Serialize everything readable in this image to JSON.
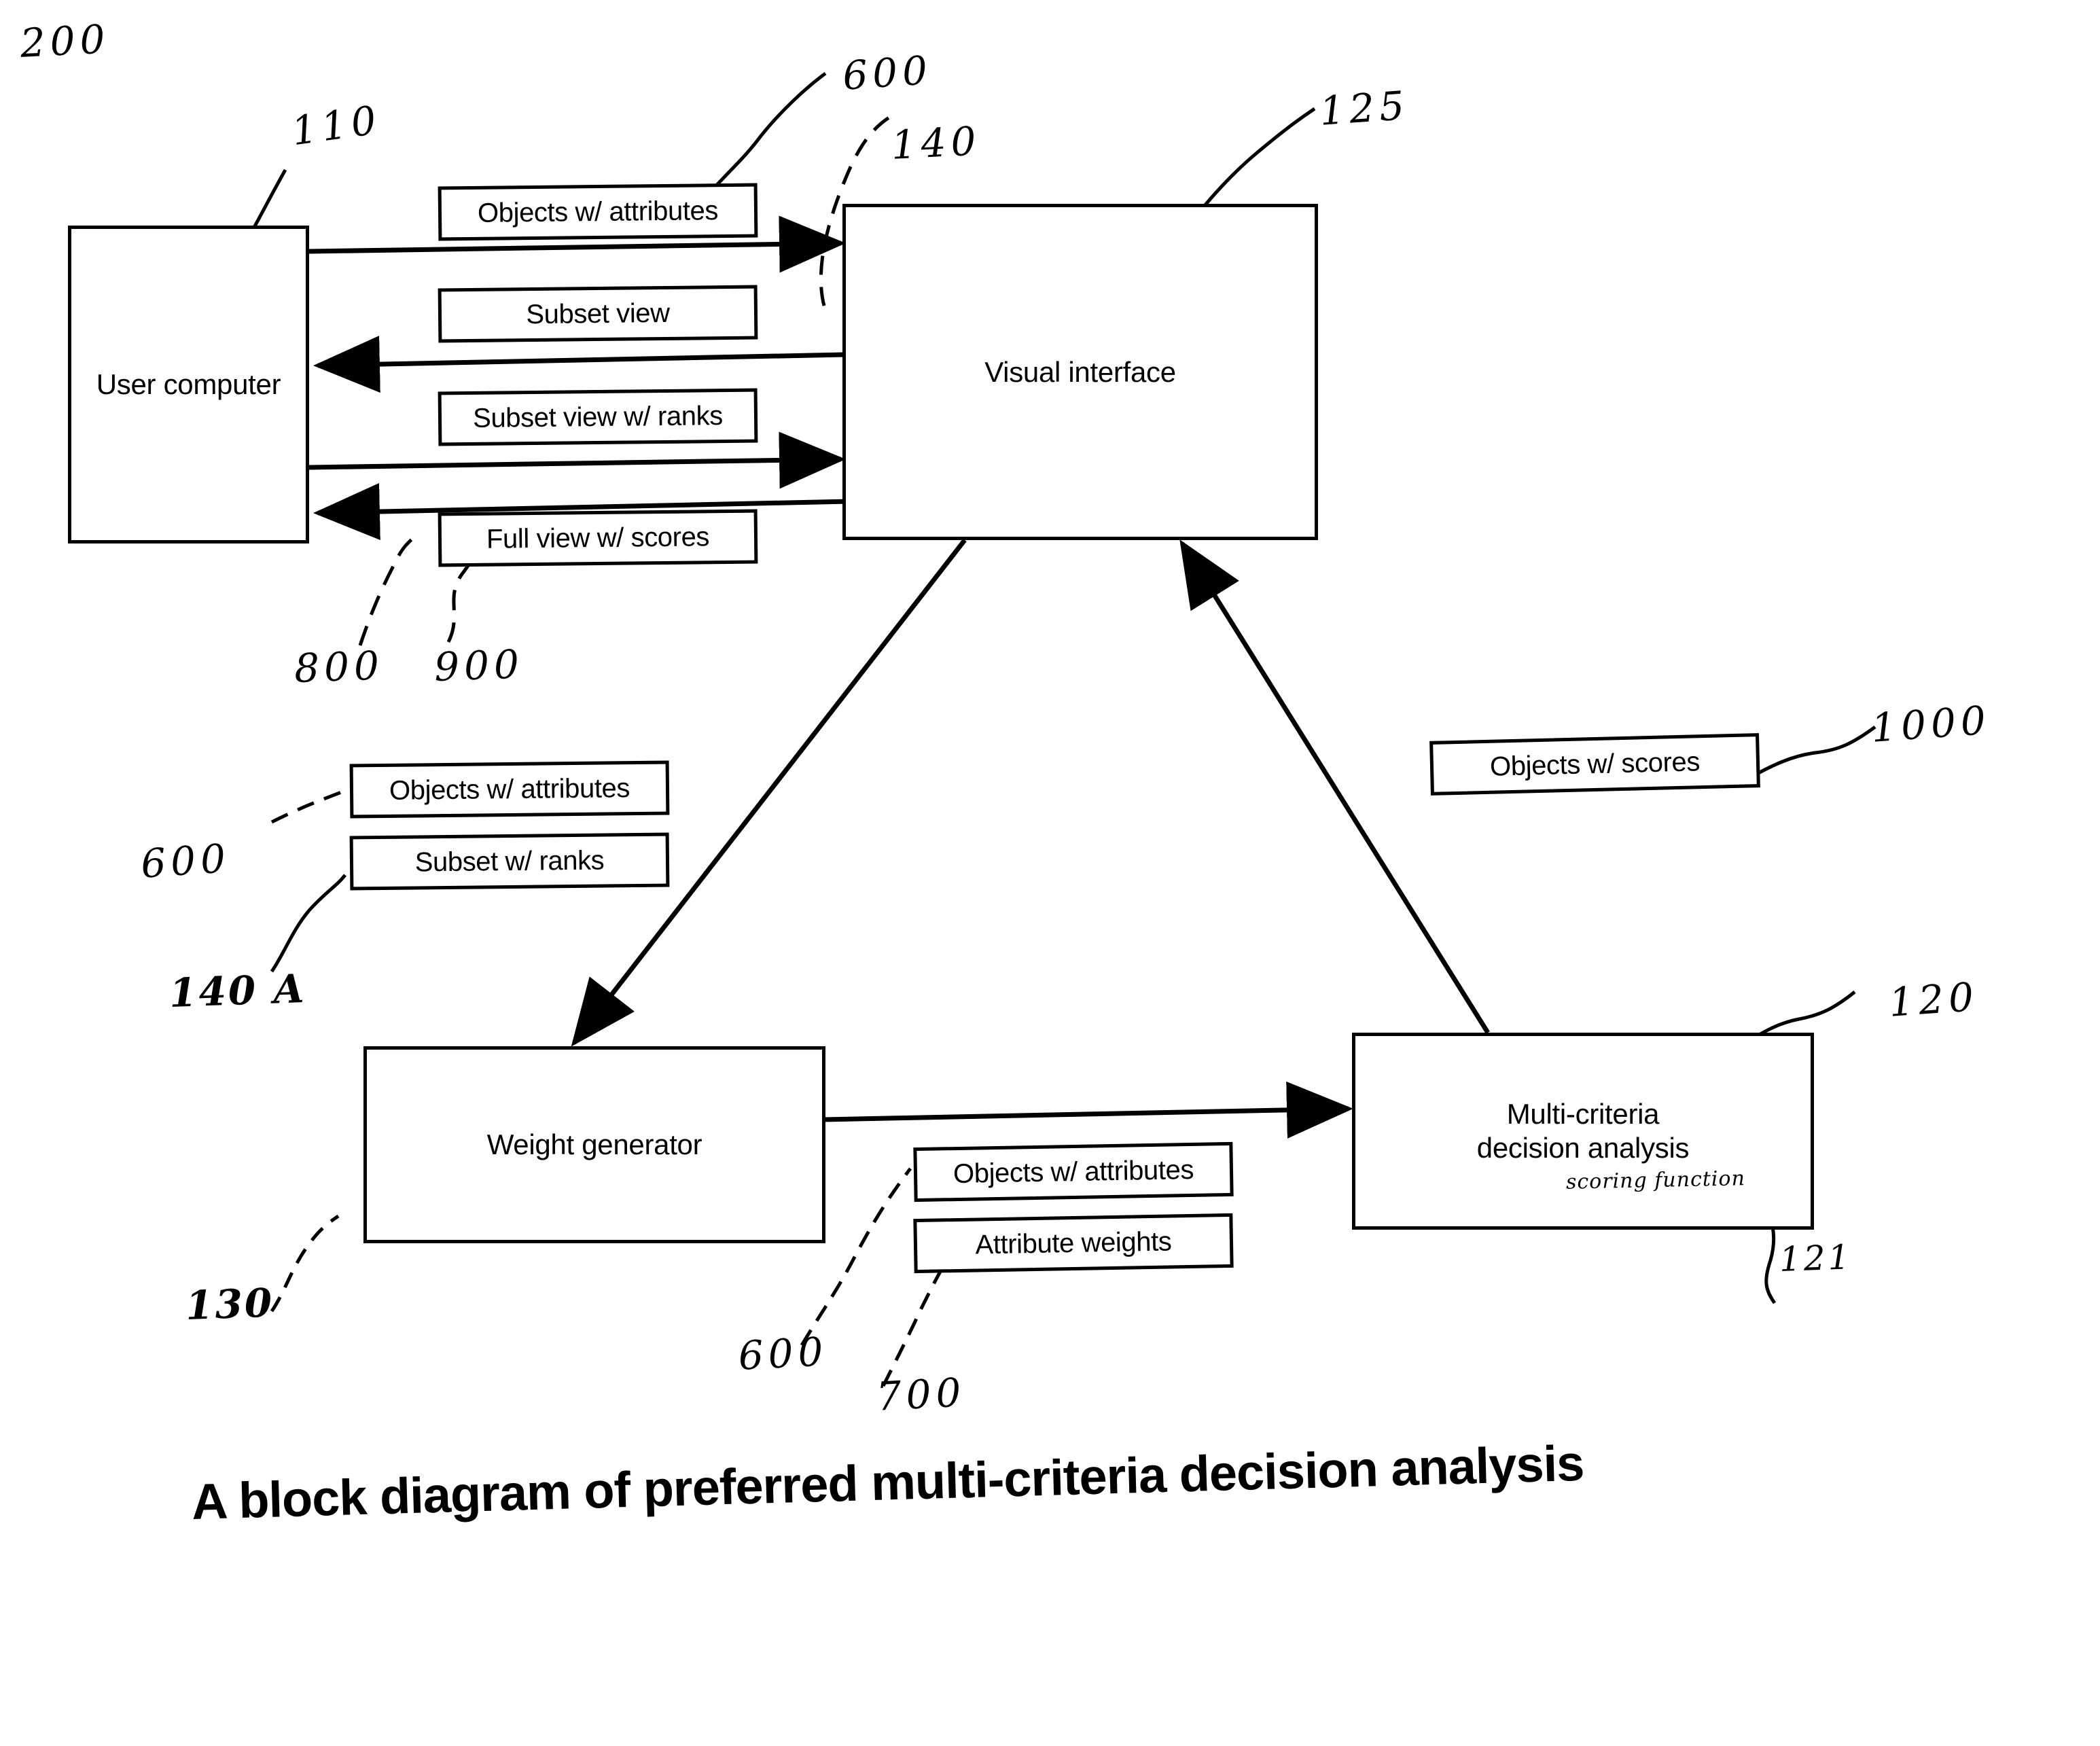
{
  "figure": {
    "caption": "A block diagram of preferred multi-criteria decision analysis",
    "top_reference_numeral": "200"
  },
  "nodes": [
    {
      "id": "user_computer",
      "label": "User computer",
      "numeral": "110"
    },
    {
      "id": "visual_interface",
      "label": "Visual interface",
      "numeral": "125"
    },
    {
      "id": "weight_generator",
      "label": "Weight generator",
      "numeral": "130"
    },
    {
      "id": "mcda",
      "label": "Multi-criteria\ndecision analysis",
      "numeral": "120"
    }
  ],
  "mcda_annotation": {
    "text": "scoring function",
    "numeral": "121"
  },
  "flows": [
    {
      "id": "f1",
      "label": "Objects w/ attributes",
      "numeral": "600",
      "direction": "user-to-interface"
    },
    {
      "id": "f2",
      "label": "Subset view",
      "numeral": "140",
      "direction": "interface-to-user"
    },
    {
      "id": "f3",
      "label": "Subset view w/ ranks",
      "numeral": "800",
      "direction": "user-to-interface"
    },
    {
      "id": "f4",
      "label": "Full view w/ scores",
      "numeral": "900",
      "direction": "interface-to-user"
    },
    {
      "id": "f5",
      "label": "Objects w/ attributes",
      "numeral": "600",
      "direction": "interface-to-weightgen"
    },
    {
      "id": "f6",
      "label": "Subset w/ ranks",
      "numeral": "140 A",
      "direction": "interface-to-weightgen"
    },
    {
      "id": "f7",
      "label": "Objects w/ attributes",
      "numeral": "600",
      "direction": "weightgen-to-mcda"
    },
    {
      "id": "f8",
      "label": "Attribute weights",
      "numeral": "700",
      "direction": "weightgen-to-mcda"
    },
    {
      "id": "f9",
      "label": "Objects w/ scores",
      "numeral": "1000",
      "direction": "mcda-to-interface"
    }
  ],
  "numerals": {
    "n200": "200",
    "n110": "110",
    "n600_top": "600",
    "n140": "140",
    "n125": "125",
    "n800": "800",
    "n900": "900",
    "n600_mid": "600",
    "n140A": "140 A",
    "n1000": "1000",
    "n120": "120",
    "n121": "121",
    "n130": "130",
    "n600_bottom": "600",
    "n700": "700"
  },
  "colors": {
    "ink": "#000000",
    "paper": "#ffffff"
  }
}
